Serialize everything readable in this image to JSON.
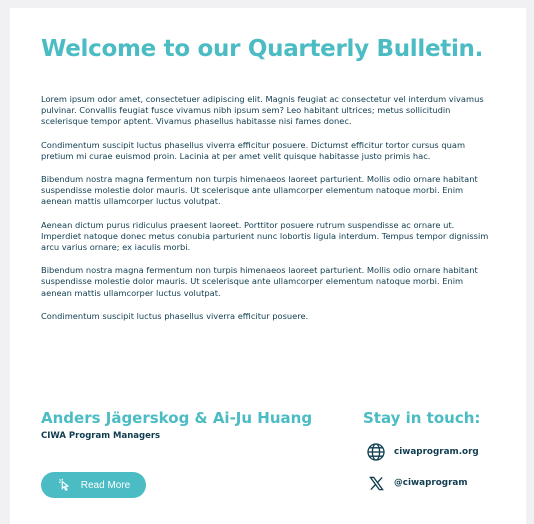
{
  "bulletin": {
    "title": "Welcome to our Quarterly Bulletin.",
    "paragraphs": [
      "Lorem ipsum odor amet, consectetuer adipiscing elit. Magnis feugiat ac consectetur vel interdum vivamus pulvinar. Convallis feugiat fusce vivamus nibh ipsum sem? Leo habitant ultrices; metus sollicitudin scelerisque tempor aptent. Vivamus phasellus habitasse nisi fames donec.",
      "Condimentum suscipit luctus phasellus viverra efficitur posuere. Dictumst efficitur tortor cursus quam pretium mi curae euismod proin. Lacinia at per amet velit quisque habitasse justo primis hac.",
      "Bibendum nostra magna fermentum non turpis himenaeos laoreet parturient. Mollis odio ornare habitant suspendisse molestie dolor mauris. Ut scelerisque ante ullamcorper elementum natoque morbi. Enim aenean mattis ullamcorper luctus volutpat.",
      "Aenean dictum purus ridiculus praesent laoreet. Porttitor posuere rutrum suspendisse ac ornare ut. Imperdiet natoque donec metus conubia parturient nunc lobortis ligula interdum. Tempus tempor dignissim arcu varius ornare; ex iaculis morbi.",
      "Bibendum nostra magna fermentum non turpis himenaeos laoreet parturient. Mollis odio ornare habitant suspendisse molestie dolor mauris. Ut scelerisque ante ullamcorper elementum natoque morbi. Enim aenean mattis ullamcorper luctus volutpat.",
      "Condimentum suscipit luctus phasellus viverra efficitur posuere."
    ]
  },
  "signature": {
    "names": "Anders Jägerskog & Ai-Ju Huang",
    "role": "CIWA Program Managers"
  },
  "contact": {
    "heading": "Stay in touch:",
    "website": {
      "icon": "globe-icon",
      "label": "ciwaprogram.org"
    },
    "x": {
      "icon": "x-logo-icon",
      "label": "@ciwaprogram"
    }
  },
  "read_more": {
    "icon": "pointer-click-icon",
    "label": "Read More"
  },
  "colors": {
    "accent": "#4bbcc4",
    "text": "#0f3d4f",
    "background": "#f1f1f3",
    "card": "#ffffff"
  }
}
